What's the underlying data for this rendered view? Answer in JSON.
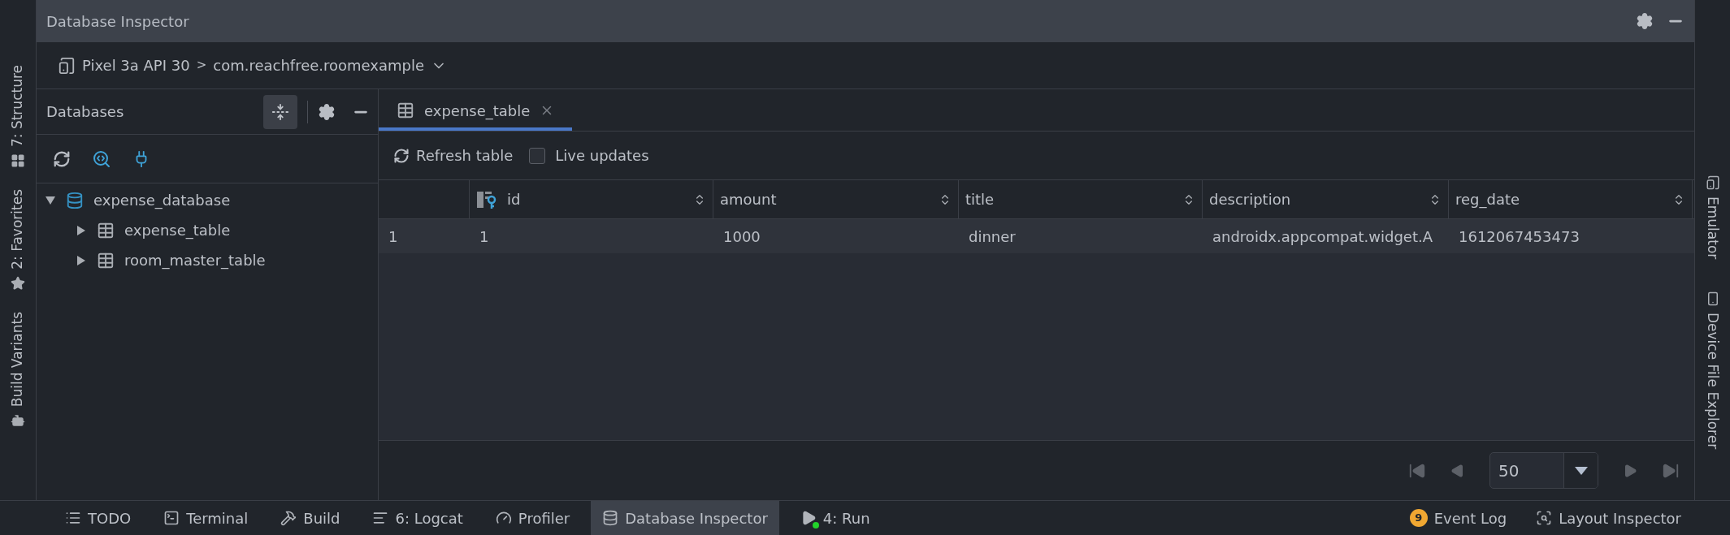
{
  "window": {
    "title": "Database Inspector"
  },
  "breadcrumb": {
    "device": "Pixel 3a API 30",
    "separator": ">",
    "app": "com.reachfree.roomexample"
  },
  "left_stripe": [
    {
      "label": "7: Structure"
    },
    {
      "label": "2: Favorites"
    },
    {
      "label": "Build Variants"
    }
  ],
  "right_stripe": [
    {
      "label": "Emulator"
    },
    {
      "label": "Device File Explorer"
    }
  ],
  "databases_panel": {
    "title": "Databases",
    "tree": [
      {
        "label": "expense_database",
        "kind": "database",
        "expanded": true,
        "children": [
          {
            "label": "expense_table",
            "kind": "table",
            "expanded": false
          },
          {
            "label": "room_master_table",
            "kind": "table",
            "expanded": false
          }
        ]
      }
    ]
  },
  "tabs": [
    {
      "label": "expense_table",
      "selected": true
    }
  ],
  "table_toolbar": {
    "refresh": "Refresh table",
    "live_updates": {
      "label": "Live updates",
      "checked": false
    }
  },
  "table": {
    "columns": [
      {
        "kind": "row_number"
      },
      {
        "kind": "data",
        "label": "id",
        "primary_key": true
      },
      {
        "kind": "data",
        "label": "amount",
        "primary_key": false
      },
      {
        "kind": "data",
        "label": "title",
        "primary_key": false
      },
      {
        "kind": "data",
        "label": "description",
        "primary_key": false
      },
      {
        "kind": "data",
        "label": "reg_date",
        "primary_key": false
      }
    ],
    "rows": [
      [
        "1",
        "1",
        "1000",
        "dinner",
        "androidx.appcompat.widget.A",
        "1612067453473"
      ]
    ]
  },
  "pagination": {
    "page_size": "50"
  },
  "bottom_bar": {
    "left": [
      {
        "label": "TODO",
        "selected": false
      },
      {
        "label": "Terminal",
        "selected": false
      },
      {
        "label": "Build",
        "selected": false
      },
      {
        "label": "6: Logcat",
        "selected": false
      },
      {
        "label": "Profiler",
        "selected": false
      },
      {
        "label": "Database Inspector",
        "selected": true
      },
      {
        "label": "4: Run",
        "selected": false
      }
    ],
    "right": [
      {
        "label": "Event Log",
        "badge": "9"
      },
      {
        "label": "Layout Inspector"
      }
    ]
  }
}
